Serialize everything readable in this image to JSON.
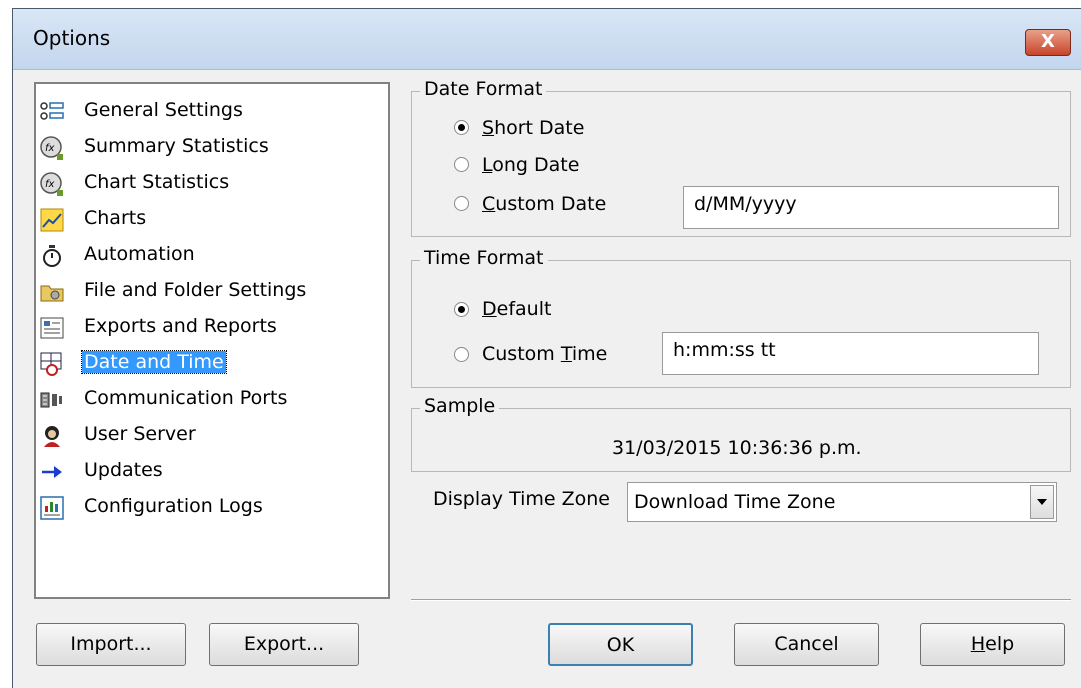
{
  "window": {
    "title": "Options",
    "close_glyph": "X"
  },
  "sidebar": {
    "items": [
      {
        "label": "General Settings",
        "icon": "list-settings-icon"
      },
      {
        "label": "Summary Statistics",
        "icon": "fx-statistics-icon"
      },
      {
        "label": "Chart Statistics",
        "icon": "fx-statistics-icon"
      },
      {
        "label": "Charts",
        "icon": "line-chart-icon"
      },
      {
        "label": "Automation",
        "icon": "stopwatch-icon"
      },
      {
        "label": "File and Folder Settings",
        "icon": "folder-settings-icon"
      },
      {
        "label": "Exports and Reports",
        "icon": "report-icon"
      },
      {
        "label": "Date and Time",
        "icon": "calendar-clock-icon",
        "selected": true
      },
      {
        "label": "Communication Ports",
        "icon": "port-icon"
      },
      {
        "label": "User Server",
        "icon": "user-server-icon"
      },
      {
        "label": "Updates",
        "icon": "arrow-right-icon"
      },
      {
        "label": "Configuration Logs",
        "icon": "log-chart-icon"
      }
    ]
  },
  "date_format": {
    "legend": "Date Format",
    "short_date": {
      "label_u": "S",
      "label_rest": "hort Date",
      "checked": true
    },
    "long_date": {
      "label_u": "L",
      "label_rest": "ong Date",
      "checked": false
    },
    "custom_date": {
      "label_u": "C",
      "label_rest": "ustom Date",
      "checked": false,
      "value": "d/MM/yyyy"
    }
  },
  "time_format": {
    "legend": "Time Format",
    "default": {
      "label_u": "D",
      "label_rest": "efault",
      "checked": true
    },
    "custom_time": {
      "label_pre": "Custom ",
      "label_u": "T",
      "label_rest": "ime",
      "checked": false,
      "value": "h:mm:ss tt"
    }
  },
  "sample": {
    "legend": "Sample",
    "value": "31/03/2015 10:36:36 p.m."
  },
  "time_zone": {
    "label": "Display Time Zone",
    "selected": "Download Time Zone"
  },
  "buttons": {
    "import": "Import...",
    "export": "Export...",
    "ok": "OK",
    "cancel": "Cancel",
    "help_u": "H",
    "help_rest": "elp"
  },
  "colors": {
    "selection": "#3399ff",
    "titlebar": "#c8d9ef",
    "close_button": "#c8452a",
    "dialog_bg": "#f0f0f0"
  }
}
